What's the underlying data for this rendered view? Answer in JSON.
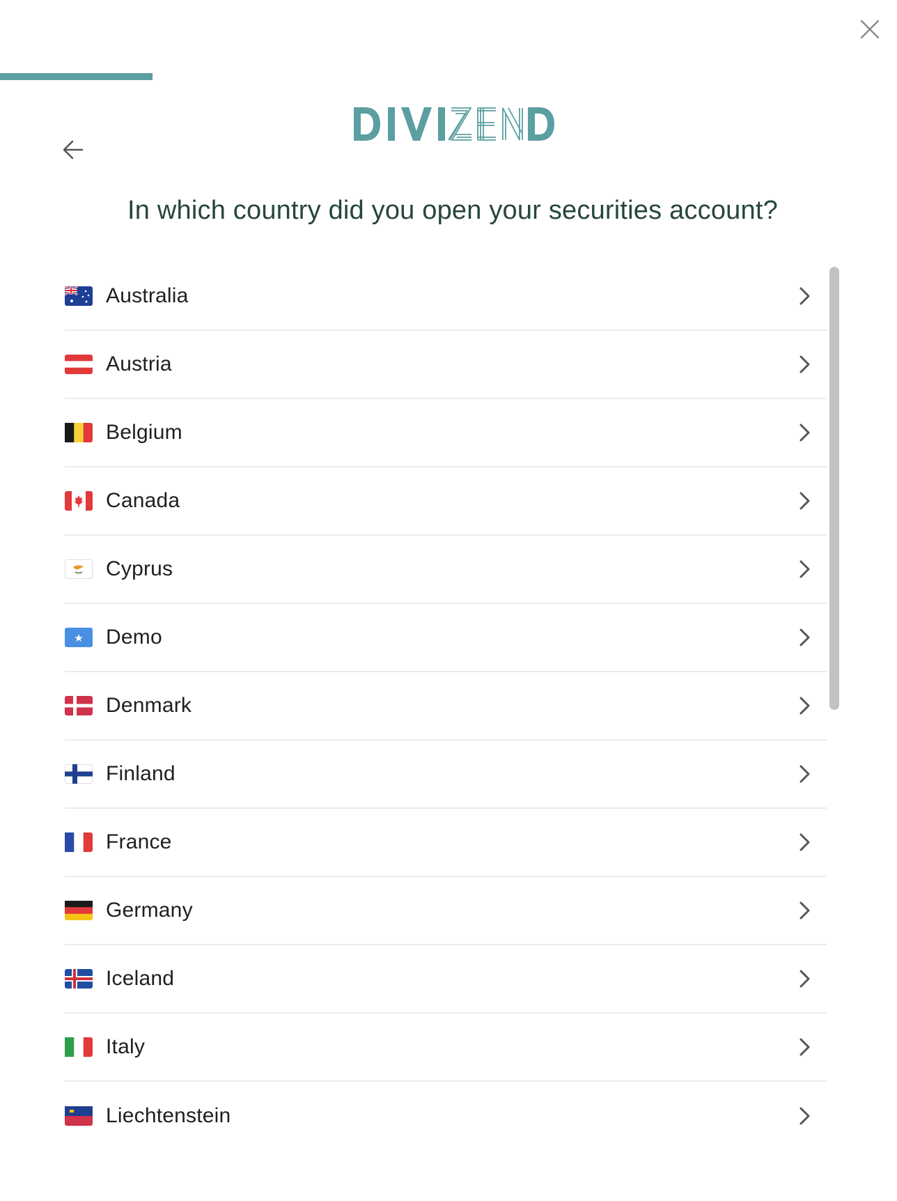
{
  "app": {
    "brand": "DIVIZEND",
    "accent_color": "#5b9fa1",
    "progress": 0.17
  },
  "header": {
    "close_icon": "close-icon",
    "back_icon": "arrow-left-icon"
  },
  "question": "In which country did you open your securities account?",
  "countries": [
    {
      "label": "Australia",
      "flag": "au-flag-icon"
    },
    {
      "label": "Austria",
      "flag": "at-flag-icon"
    },
    {
      "label": "Belgium",
      "flag": "be-flag-icon"
    },
    {
      "label": "Canada",
      "flag": "ca-flag-icon"
    },
    {
      "label": "Cyprus",
      "flag": "cy-flag-icon"
    },
    {
      "label": "Demo",
      "flag": "so-flag-icon"
    },
    {
      "label": "Denmark",
      "flag": "dk-flag-icon"
    },
    {
      "label": "Finland",
      "flag": "fi-flag-icon"
    },
    {
      "label": "France",
      "flag": "fr-flag-icon"
    },
    {
      "label": "Germany",
      "flag": "de-flag-icon"
    },
    {
      "label": "Iceland",
      "flag": "is-flag-icon"
    },
    {
      "label": "Italy",
      "flag": "it-flag-icon"
    },
    {
      "label": "Liechtenstein",
      "flag": "li-flag-icon"
    }
  ]
}
